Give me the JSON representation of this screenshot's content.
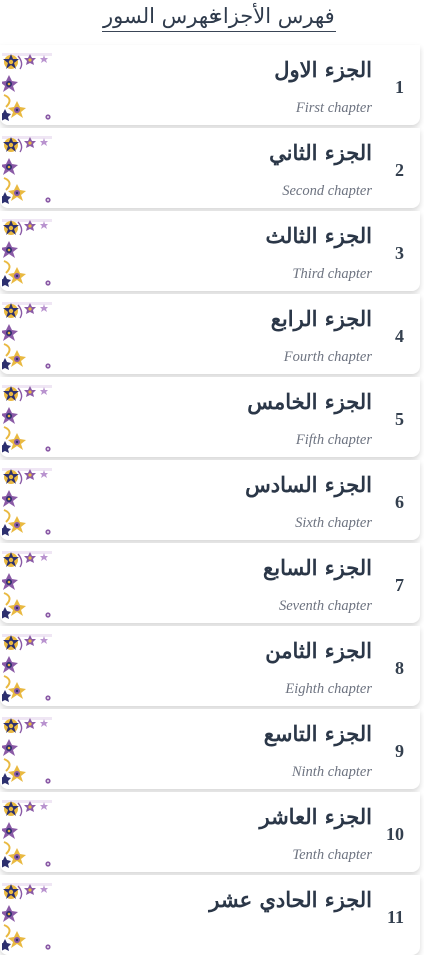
{
  "tabs": {
    "juz_index": "فهرس الأجزاء",
    "surah_index": "فهرس السور"
  },
  "colors": {
    "ornament_gold": "#e9b941",
    "ornament_purple": "#8a5aa6",
    "ornament_navy": "#2c2f6e",
    "text_dark": "#2b3748",
    "text_muted": "#6d7380"
  },
  "icons": {
    "row_ornament": "islamic-corner-ornament-icon"
  },
  "chapters": [
    {
      "number": "1",
      "arabic": "الجزء الاول",
      "english": "First chapter"
    },
    {
      "number": "2",
      "arabic": "الجزء الثاني",
      "english": "Second chapter"
    },
    {
      "number": "3",
      "arabic": "الجزء الثالث",
      "english": "Third chapter"
    },
    {
      "number": "4",
      "arabic": "الجزء الرابع",
      "english": "Fourth chapter"
    },
    {
      "number": "5",
      "arabic": "الجزء الخامس",
      "english": "Fifth chapter"
    },
    {
      "number": "6",
      "arabic": "الجزء السادس",
      "english": "Sixth chapter"
    },
    {
      "number": "7",
      "arabic": "الجزء السابع",
      "english": "Seventh chapter"
    },
    {
      "number": "8",
      "arabic": "الجزء الثامن",
      "english": "Eighth chapter"
    },
    {
      "number": "9",
      "arabic": "الجزء التاسع",
      "english": "Ninth chapter"
    },
    {
      "number": "10",
      "arabic": "الجزء العاشر",
      "english": "Tenth chapter"
    },
    {
      "number": "11",
      "arabic": "الجزء الحادي عشر",
      "english": ""
    }
  ]
}
